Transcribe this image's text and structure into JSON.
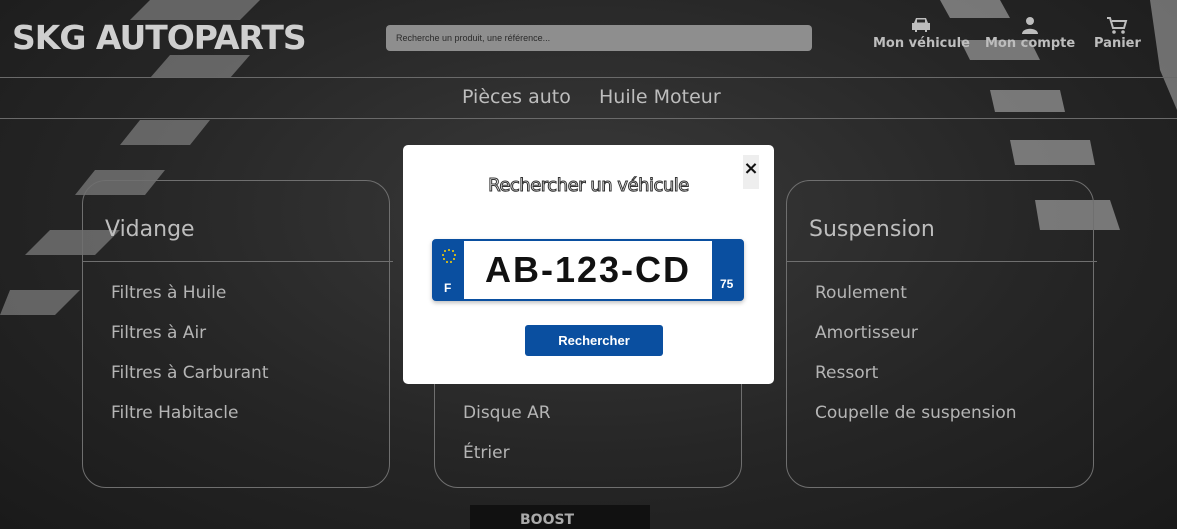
{
  "header": {
    "logo": "SKG AUTOPARTS",
    "search_placeholder": "Recherche un produit, une référence...",
    "nav": [
      {
        "label": "Mon véhicule",
        "icon": "car-icon"
      },
      {
        "label": "Mon compte",
        "icon": "user-icon"
      },
      {
        "label": "Panier",
        "icon": "cart-icon"
      }
    ]
  },
  "menu": [
    "Pièces auto",
    "Huile Moteur"
  ],
  "cards": [
    {
      "title": "Vidange",
      "items": [
        "Filtres à Huile",
        "Filtres à Air",
        "Filtres à Carburant",
        "Filtre Habitacle"
      ]
    },
    {
      "title": "",
      "items": [
        "Disque AR",
        "Étrier"
      ]
    },
    {
      "title": "Suspension",
      "items": [
        "Roulement",
        "Amortisseur",
        "Ressort",
        "Coupelle de suspension"
      ]
    }
  ],
  "modal": {
    "close": "×",
    "title": "Rechercher un véhicule",
    "plate": {
      "country": "F",
      "number": "AB-123-CD",
      "department": "75"
    },
    "button": "Rechercher"
  },
  "colors": {
    "accent": "#0a4fa0"
  }
}
